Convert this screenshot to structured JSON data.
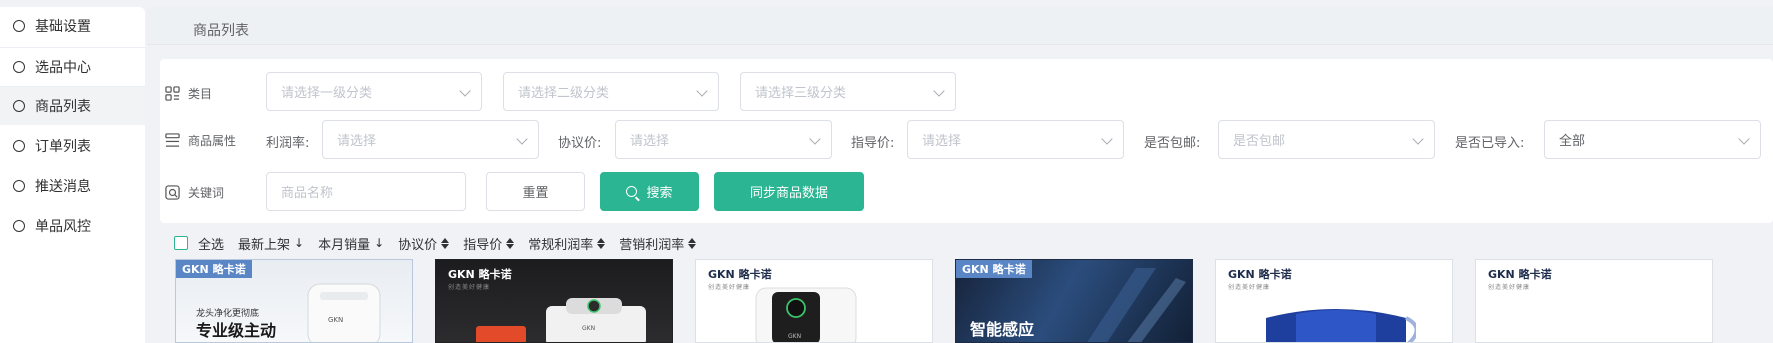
{
  "sidebar": {
    "items": [
      {
        "label": "基础设置"
      },
      {
        "label": "选品中心"
      },
      {
        "label": "商品列表"
      },
      {
        "label": "订单列表"
      },
      {
        "label": "推送消息"
      },
      {
        "label": "单品风控"
      }
    ]
  },
  "header": {
    "title": "商品列表"
  },
  "filters": {
    "category": {
      "label": "类目",
      "level1_placeholder": "请选择一级分类",
      "level2_placeholder": "请选择二级分类",
      "level3_placeholder": "请选择三级分类"
    },
    "attributes": {
      "label": "商品属性",
      "profit_rate": {
        "label": "利润率:",
        "placeholder": "请选择"
      },
      "agreement_price": {
        "label": "协议价:",
        "placeholder": "请选择"
      },
      "guide_price": {
        "label": "指导价:",
        "placeholder": "请选择"
      },
      "free_shipping": {
        "label": "是否包邮:",
        "placeholder": "是否包邮"
      },
      "imported": {
        "label": "是否已导入:",
        "value": "全部"
      }
    },
    "keyword": {
      "label": "关键词",
      "placeholder": "商品名称",
      "reset_label": "重置",
      "search_label": "搜索",
      "sync_label": "同步商品数据"
    }
  },
  "sortbar": {
    "select_all": "全选",
    "sorts": [
      "最新上架",
      "本月销量",
      "协议价",
      "指导价",
      "常规利润率",
      "营销利润率"
    ]
  },
  "products": [
    {
      "brand": "GKN 略卡诺",
      "headline": "专业级主动",
      "subline": "龙头净化更彻底"
    },
    {
      "brand": "GKN 略卡诺",
      "subline": "创造美好健康"
    },
    {
      "brand": "GKN 略卡诺",
      "subline": "创造美好健康"
    },
    {
      "brand": "GKN 略卡诺",
      "headline": "智能感应"
    },
    {
      "brand": "GKN 略卡诺",
      "subline": "创造美好健康"
    },
    {
      "brand": "GKN 略卡诺",
      "subline": "创造美好健康"
    }
  ],
  "colors": {
    "primary": "#2bb592",
    "sidebar_bg": "#ffffff",
    "page_bg": "#f0f2f5"
  }
}
